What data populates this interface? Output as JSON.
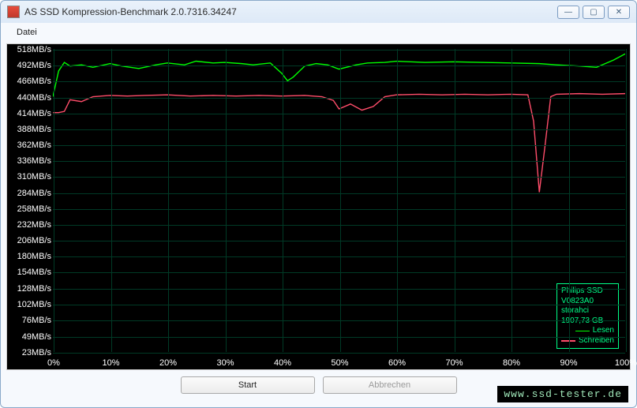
{
  "window": {
    "title": "AS SSD Kompression-Benchmark 2.0.7316.34247",
    "min_icon": "—",
    "max_icon": "▢",
    "close_icon": "✕"
  },
  "menu": {
    "datei": "Datei"
  },
  "buttons": {
    "start": "Start",
    "abort": "Abbrechen"
  },
  "watermark": "www.ssd-tester.de",
  "legend": {
    "line1": "Philips SSD",
    "line2": "V0823A0",
    "line3": "storahci",
    "line4": "1907,73 GB",
    "read": "Lesen",
    "write": "Schreiben",
    "read_color": "#00ff00",
    "write_color": "#ff4d6a"
  },
  "chart_data": {
    "type": "line",
    "xlabel": "",
    "ylabel": "",
    "x_unit": "%",
    "y_unit": "MB/s",
    "xlim": [
      0,
      100
    ],
    "ylim": [
      23,
      518
    ],
    "y_ticks": [
      518,
      492,
      466,
      440,
      414,
      388,
      362,
      336,
      310,
      284,
      258,
      232,
      206,
      180,
      154,
      128,
      102,
      76,
      49,
      23
    ],
    "y_tick_labels": [
      "518MB/s",
      "492MB/s",
      "466MB/s",
      "440MB/s",
      "414MB/s",
      "388MB/s",
      "362MB/s",
      "336MB/s",
      "310MB/s",
      "284MB/s",
      "258MB/s",
      "232MB/s",
      "206MB/s",
      "180MB/s",
      "154MB/s",
      "128MB/s",
      "102MB/s",
      "76MB/s",
      "49MB/s",
      "23MB/s"
    ],
    "x_ticks": [
      0,
      10,
      20,
      30,
      40,
      50,
      60,
      70,
      80,
      90,
      100
    ],
    "x_tick_labels": [
      "0%",
      "10%",
      "20%",
      "30%",
      "40%",
      "50%",
      "60%",
      "70%",
      "80%",
      "90%",
      "100%"
    ],
    "series": [
      {
        "name": "Lesen",
        "color": "#00ff00",
        "x": [
          0,
          1,
          2,
          3,
          5,
          7,
          10,
          12,
          15,
          18,
          20,
          23,
          25,
          28,
          30,
          33,
          35,
          38,
          40,
          41,
          42,
          44,
          46,
          48,
          50,
          53,
          55,
          58,
          60,
          65,
          70,
          75,
          80,
          85,
          88,
          92,
          95,
          98,
          100
        ],
        "values": [
          440,
          482,
          496,
          490,
          492,
          488,
          494,
          490,
          486,
          492,
          495,
          492,
          498,
          495,
          496,
          494,
          492,
          495,
          478,
          466,
          472,
          490,
          494,
          492,
          485,
          492,
          495,
          496,
          498,
          496,
          497,
          496,
          495,
          494,
          492,
          490,
          488,
          500,
          510
        ]
      },
      {
        "name": "Schreiben",
        "color": "#ff4d6a",
        "x": [
          0,
          1,
          2,
          3,
          5,
          7,
          10,
          13,
          16,
          20,
          24,
          28,
          32,
          36,
          40,
          44,
          47,
          49,
          50,
          52,
          54,
          56,
          58,
          60,
          64,
          68,
          72,
          76,
          80,
          83,
          84,
          85,
          86,
          87,
          88,
          92,
          96,
          100
        ],
        "values": [
          414,
          414,
          416,
          435,
          432,
          440,
          442,
          441,
          442,
          443,
          441,
          442,
          441,
          442,
          441,
          442,
          440,
          434,
          420,
          428,
          418,
          424,
          440,
          443,
          444,
          443,
          444,
          443,
          444,
          443,
          400,
          284,
          360,
          440,
          444,
          445,
          444,
          445
        ]
      }
    ]
  }
}
